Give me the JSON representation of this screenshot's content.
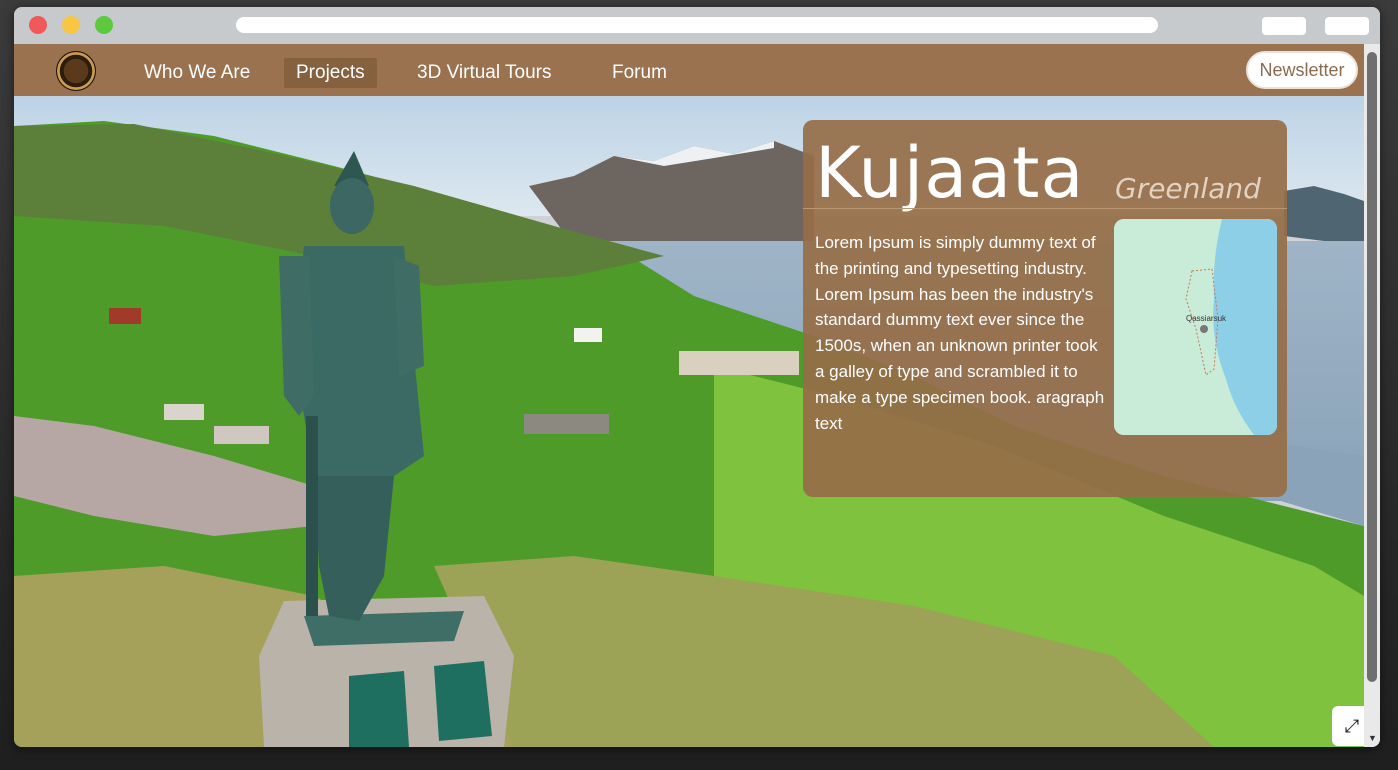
{
  "window": {
    "controls": [
      "close",
      "minimize",
      "maximize"
    ]
  },
  "nav": {
    "items": [
      {
        "label": "Who We Are",
        "active": false
      },
      {
        "label": "Projects",
        "active": true
      },
      {
        "label": "3D Virtual Tours",
        "active": false
      },
      {
        "label": "Forum",
        "active": false
      }
    ],
    "newsletter": "Newsletter",
    "logo": "society-seal-logo"
  },
  "card": {
    "title": "Kujaata",
    "subtitle": "Greenland",
    "body": "Lorem Ipsum is simply dummy text of the printing and typesetting industry. Lorem Ipsum has been the industry's standard dummy text ever since the 1500s, when an unknown printer took a galley of type and scrambled it to make a type specimen book. aragraph text",
    "map_label": "Qassiarsuk"
  },
  "controls": {
    "fullscreen_icon": "expand-icon"
  },
  "colors": {
    "nav": "#9a724f",
    "nav_active": "#85613f",
    "card": "#966e48",
    "accent_text": "#8b6b4f"
  }
}
